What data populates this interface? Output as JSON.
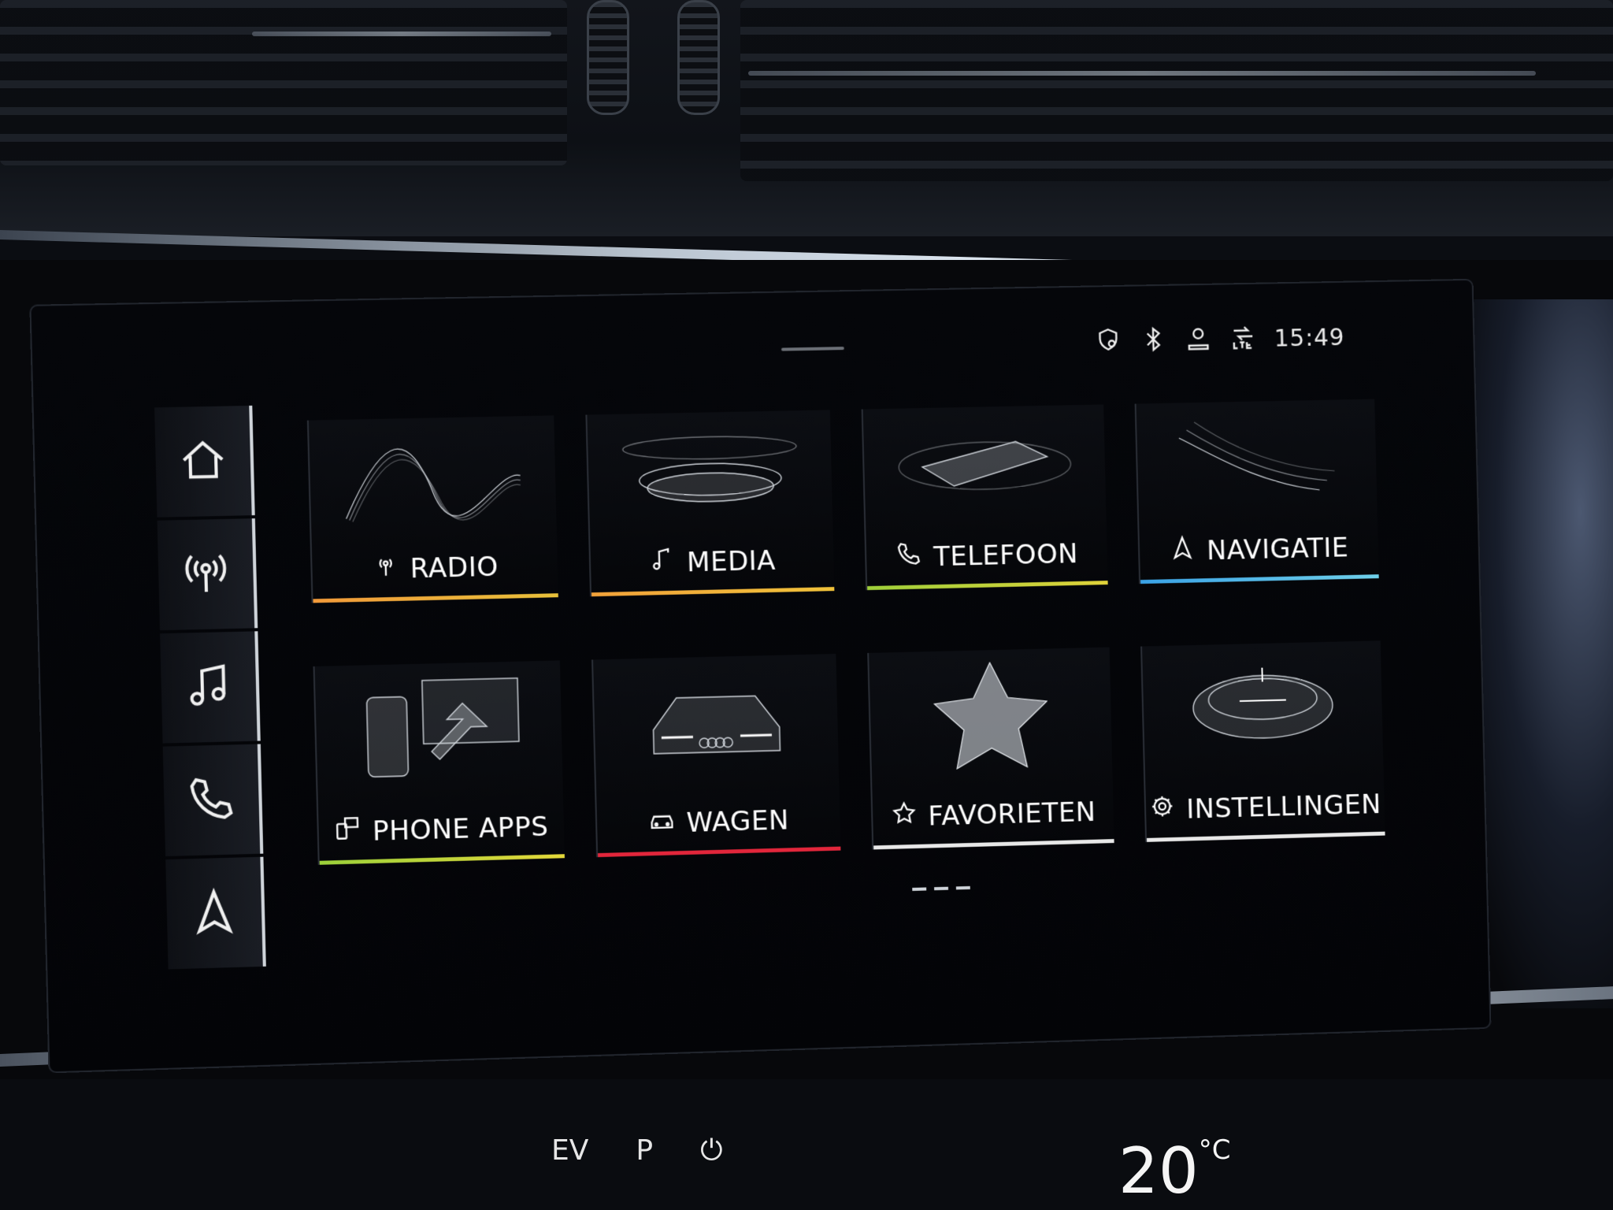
{
  "status": {
    "time": "15:49",
    "icons": [
      "shield-location-icon",
      "bluetooth-icon",
      "user-icon",
      "lte-signal-icon"
    ]
  },
  "sidebar": {
    "items": [
      {
        "icon": "home-icon"
      },
      {
        "icon": "radio-antenna-icon"
      },
      {
        "icon": "music-note-icon"
      },
      {
        "icon": "phone-icon"
      },
      {
        "icon": "navigation-arrow-icon"
      }
    ]
  },
  "tiles": [
    {
      "label": "RADIO",
      "icon": "radio-antenna-icon",
      "accent": "#f2a23a"
    },
    {
      "label": "MEDIA",
      "icon": "music-note-icon",
      "accent": "#f0b23a"
    },
    {
      "label": "TELEFOON",
      "icon": "phone-icon",
      "accent": "#b7d23a"
    },
    {
      "label": "NAVIGATIE",
      "icon": "navigation-arrow-icon",
      "accent": "#4fb6e6"
    },
    {
      "label": "PHONE APPS",
      "icon": "phone-apps-icon",
      "accent": "#b6d83c"
    },
    {
      "label": "WAGEN",
      "icon": "car-icon",
      "accent": "#e2263b"
    },
    {
      "label": "FAVORIETEN",
      "icon": "star-icon",
      "accent": "#e8e8e8"
    },
    {
      "label": "INSTELLINGEN",
      "icon": "gear-icon",
      "accent": "#e8e8e8"
    }
  ],
  "climate": {
    "labels": [
      "EV",
      "P"
    ],
    "temperature": "20",
    "unit": "°C"
  }
}
